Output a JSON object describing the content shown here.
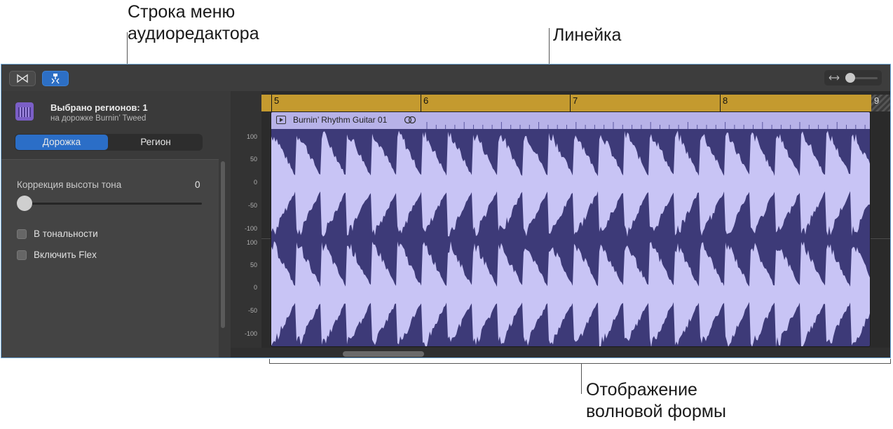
{
  "callouts": {
    "menu_bar": "Строка меню\nаудиоредактора",
    "ruler": "Линейка",
    "waveform": "Отображение\nволновой формы"
  },
  "toolbar": {
    "left_button_icon": "flex-bowtie-icon",
    "right_button_icon": "pitch-tuning-icon",
    "zoom_icon": "horizontal-zoom-icon",
    "zoom_level": 0.0
  },
  "inspector": {
    "selection_title": "Выбрано регионов: 1",
    "selection_subtitle": "на дорожке Burnin’ Tweed",
    "tabs": [
      {
        "label": "Дорожка",
        "active": true
      },
      {
        "label": "Регион",
        "active": false
      }
    ],
    "pitch_label": "Коррекция высоты тона",
    "pitch_value": "0",
    "checkbox_key": "В тональности",
    "checkbox_flex": "Включить Flex"
  },
  "ruler": {
    "bars": [
      "5",
      "6",
      "7",
      "8"
    ],
    "next_bar": "9"
  },
  "region": {
    "name": "Burnin’ Rhythm Guitar 01"
  },
  "amplitude_labels": [
    "100",
    "50",
    "0",
    "-50",
    "-100",
    "100",
    "50",
    "0",
    "-50",
    "-100"
  ],
  "colors": {
    "ruler": "#c49a2f",
    "region_header": "#b7b2e8",
    "waveform": "#c8c4f5",
    "region_body": "#3d3a78",
    "accent": "#2b6ec7"
  }
}
